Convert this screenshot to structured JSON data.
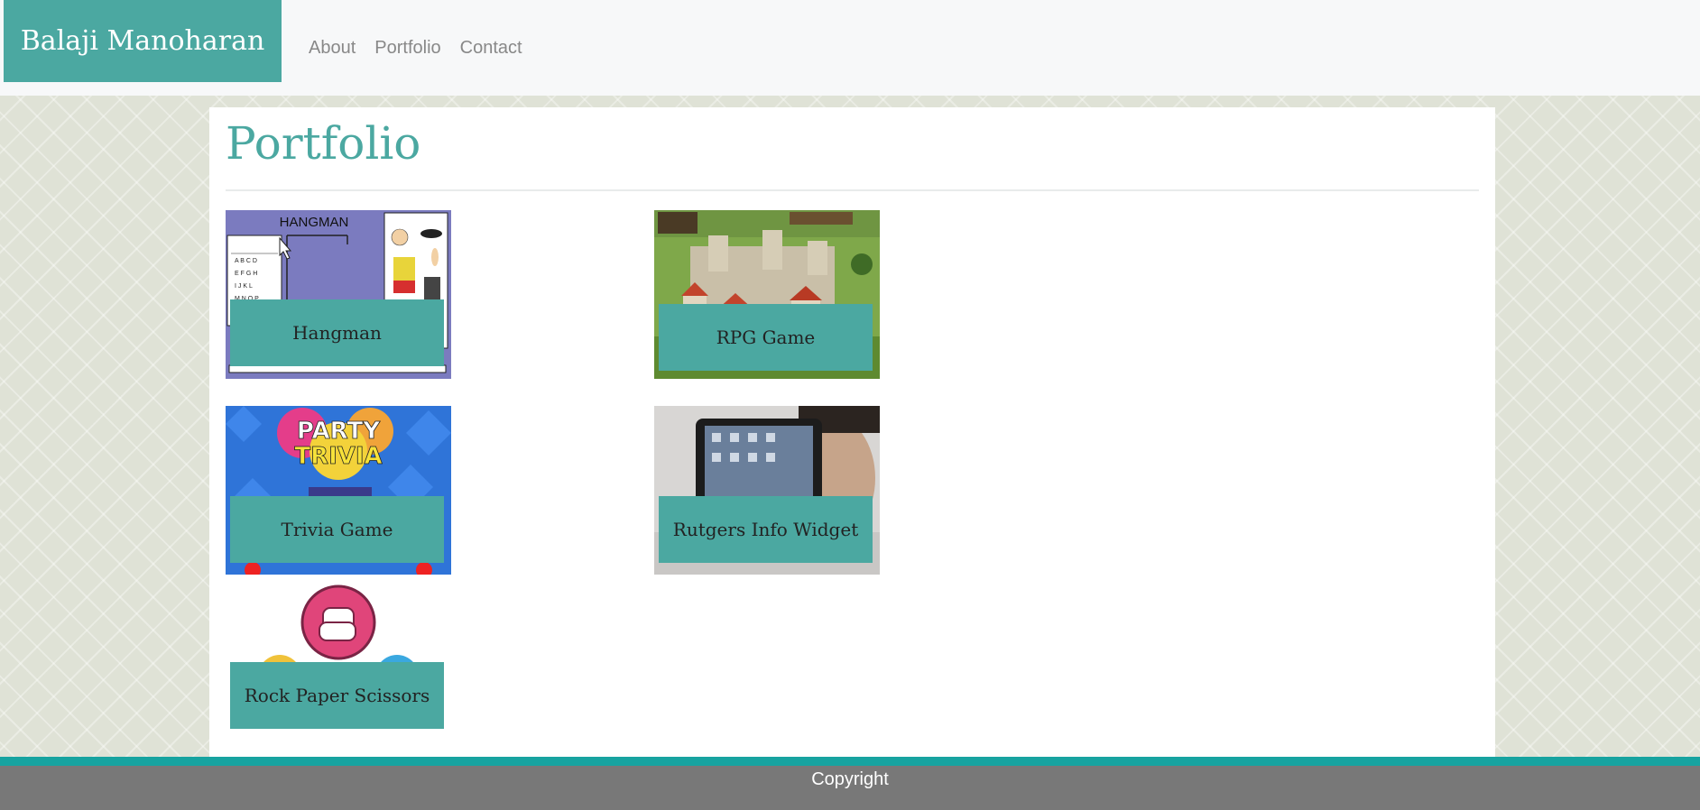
{
  "navbar": {
    "brand": "Balaji Manoharan",
    "links": [
      "About",
      "Portfolio",
      "Contact"
    ]
  },
  "page": {
    "title": "Portfolio"
  },
  "projects": [
    {
      "label": "Hangman",
      "thumbnail": "hangman-game-thumbnail",
      "thumb_text": "HANGMAN"
    },
    {
      "label": "RPG Game",
      "thumbnail": "castle-rpg-thumbnail"
    },
    {
      "label": "Trivia Game",
      "thumbnail": "party-trivia-thumbnail",
      "thumb_text": "PARTY TRIVIA"
    },
    {
      "label": "Rutgers Info Widget",
      "thumbnail": "tablet-thumbnail"
    },
    {
      "label": "Rock Paper Scissors",
      "thumbnail": "fist-icon-thumbnail"
    }
  ],
  "footer": {
    "text": "Copyright"
  },
  "colors": {
    "accent": "#4ba8a1",
    "footer_strip": "#17a3a0",
    "footer_bg": "#787878",
    "nav_bg": "#f7f8f9"
  }
}
